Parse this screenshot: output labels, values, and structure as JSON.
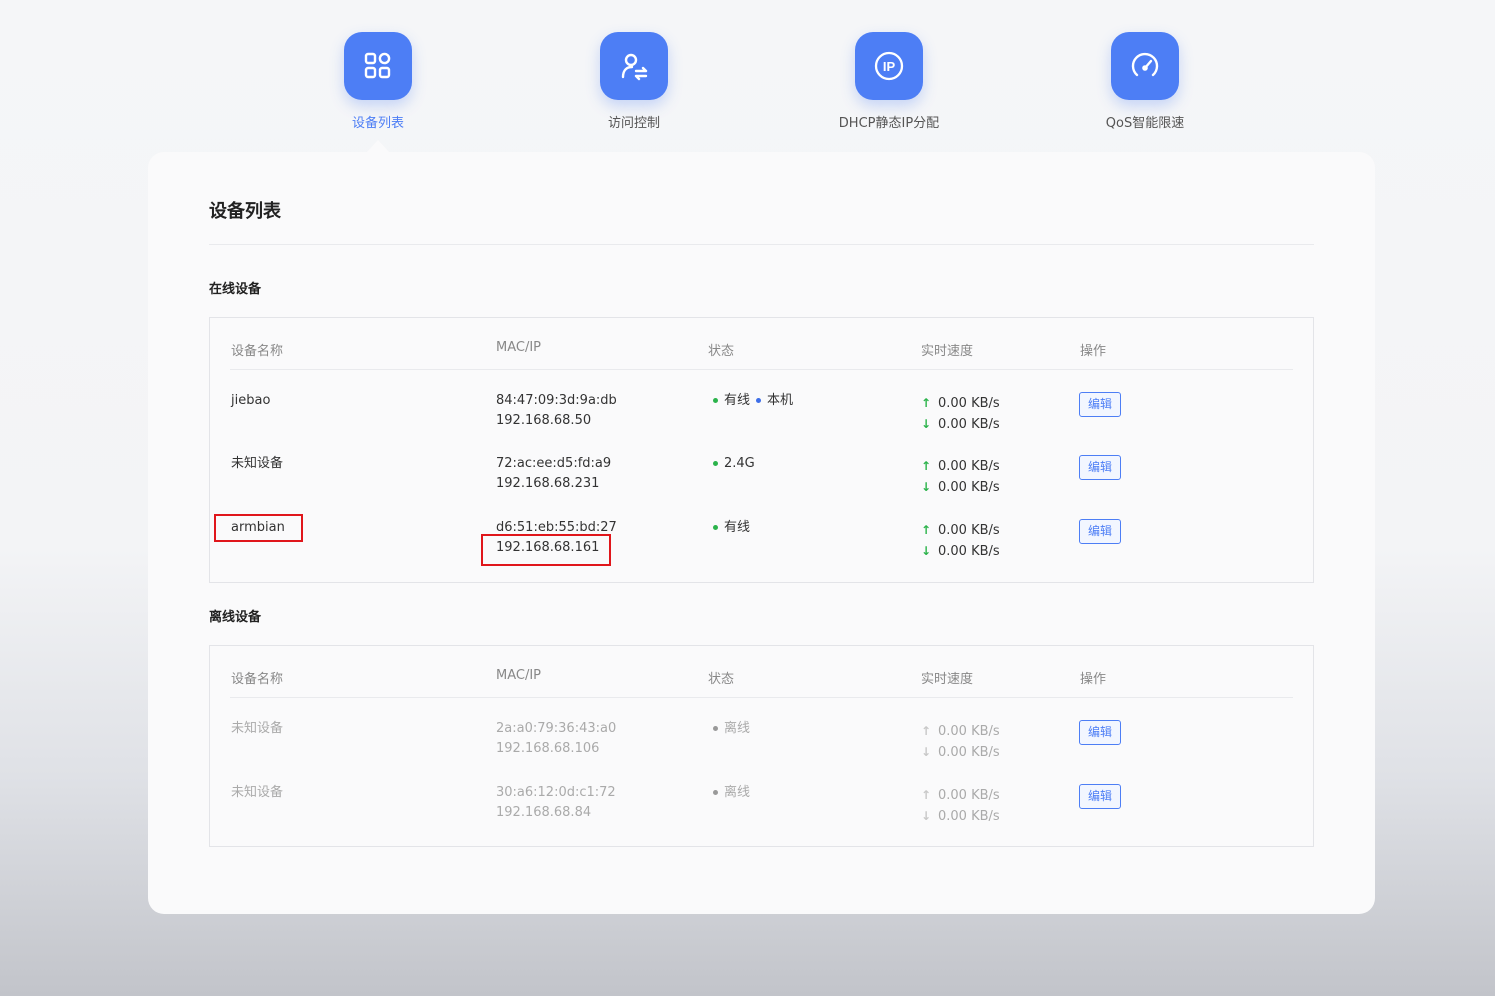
{
  "nav": [
    {
      "label": "设备列表",
      "icon": "grid-icon",
      "active": true
    },
    {
      "label": "访问控制",
      "icon": "user-switch-icon",
      "active": false
    },
    {
      "label": "DHCP静态IP分配",
      "icon": "ip-icon",
      "active": false
    },
    {
      "label": "QoS智能限速",
      "icon": "speedometer-icon",
      "active": false
    }
  ],
  "colors": {
    "accent": "#4d7ef5",
    "online": "#2bb34b",
    "local": "#3d6ee8",
    "highlight": "#e0161b"
  },
  "card": {
    "title": "设备列表"
  },
  "headers": {
    "name": "设备名称",
    "mac": "MAC/IP",
    "status": "状态",
    "speed": "实时速度",
    "op": "操作"
  },
  "online": {
    "title": "在线设备",
    "rows": [
      {
        "name": "jiebao",
        "mac": "84:47:09:3d:9a:db",
        "ip": "192.168.68.50",
        "status": "有线",
        "status2": "本机",
        "up": "0.00 KB/s",
        "down": "0.00 KB/s",
        "edit": "编辑"
      },
      {
        "name": "未知设备",
        "mac": "72:ac:ee:d5:fd:a9",
        "ip": "192.168.68.231",
        "status": "2.4G",
        "up": "0.00 KB/s",
        "down": "0.00 KB/s",
        "edit": "编辑"
      },
      {
        "name": "armbian",
        "mac": "d6:51:eb:55:bd:27",
        "ip": "192.168.68.161",
        "status": "有线",
        "up": "0.00 KB/s",
        "down": "0.00 KB/s",
        "edit": "编辑"
      }
    ]
  },
  "offline": {
    "title": "离线设备",
    "rows": [
      {
        "name": "未知设备",
        "mac": "2a:a0:79:36:43:a0",
        "ip": "192.168.68.106",
        "status": "离线",
        "up": "0.00 KB/s",
        "down": "0.00 KB/s",
        "edit": "编辑"
      },
      {
        "name": "未知设备",
        "mac": "30:a6:12:0d:c1:72",
        "ip": "192.168.68.84",
        "status": "离线",
        "up": "0.00 KB/s",
        "down": "0.00 KB/s",
        "edit": "编辑"
      }
    ]
  }
}
